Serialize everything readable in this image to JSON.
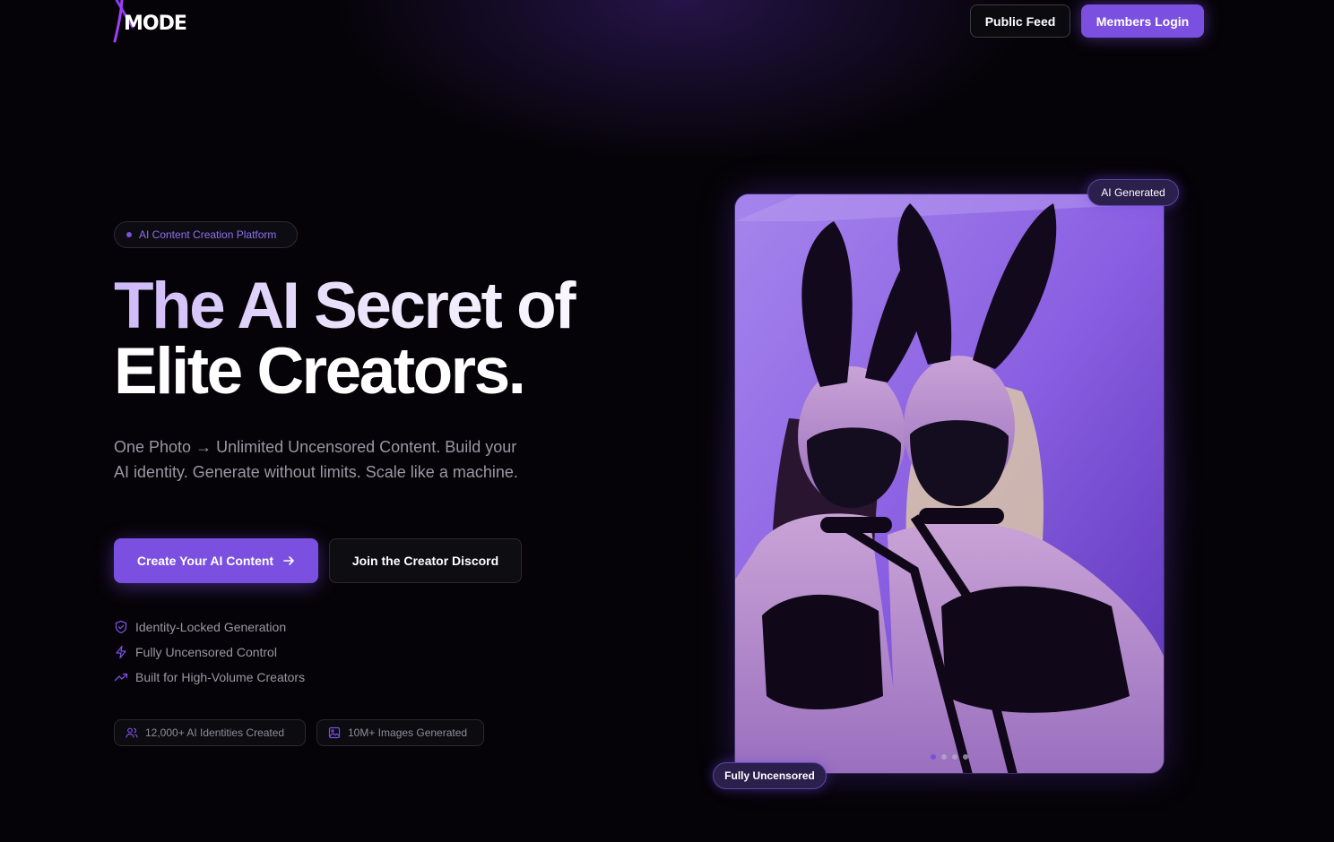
{
  "header": {
    "logo_text": "MODE",
    "public_feed_label": "Public Feed",
    "members_login_label": "Members Login"
  },
  "hero": {
    "badge": "AI Content Creation Platform",
    "headline_line1": "The AI Secret of",
    "headline_line2": "Elite Creators.",
    "subtext": "One Photo → Unlimited Uncensored Content. Build your AI identity. Generate without limits. Scale like a machine.",
    "cta_primary": "Create Your AI Content",
    "cta_secondary": "Join the Creator Discord",
    "features": [
      {
        "icon": "shield-check-icon",
        "label": "Identity-Locked Generation"
      },
      {
        "icon": "lightning-icon",
        "label": "Fully Uncensored Control"
      },
      {
        "icon": "trending-up-icon",
        "label": "Built for High-Volume Creators"
      }
    ],
    "stats": [
      {
        "icon": "users-icon",
        "label": "12,000+ AI Identities Created"
      },
      {
        "icon": "image-icon",
        "label": "10M+ Images Generated"
      }
    ]
  },
  "showcase": {
    "tag_top": "AI Generated",
    "tag_bottom": "Fully Uncensored",
    "carousel_count": 4,
    "carousel_active": 1
  },
  "colors": {
    "accent": "#7b4fe0",
    "background": "#050307",
    "muted_text": "#9a97a3"
  }
}
